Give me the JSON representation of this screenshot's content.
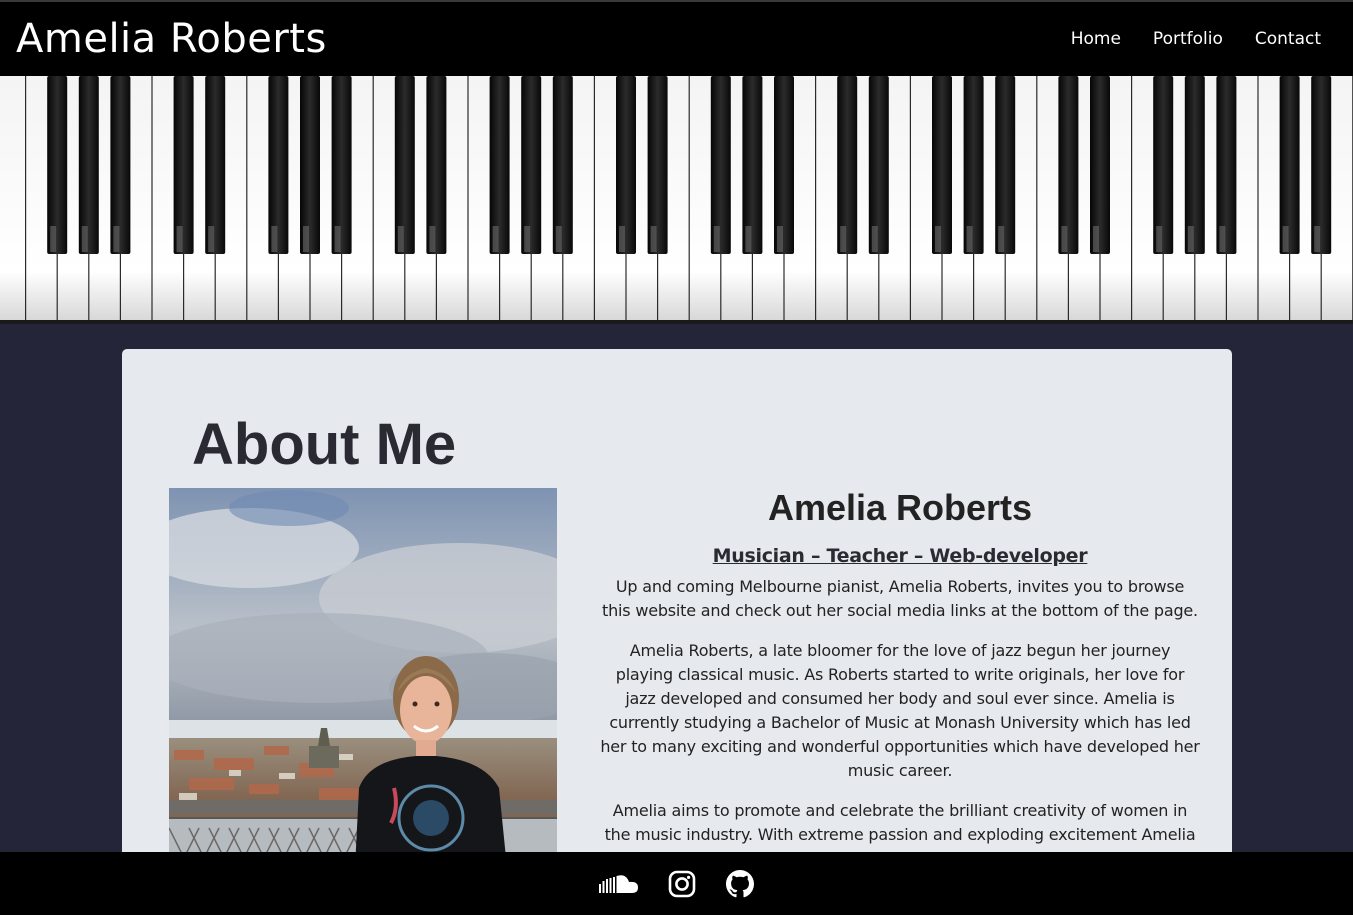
{
  "header": {
    "brand": "Amelia Roberts",
    "nav": [
      "Home",
      "Portfolio",
      "Contact"
    ]
  },
  "about": {
    "title": "About Me",
    "name": "Amelia Roberts",
    "role": "Musician – Teacher – Web-developer",
    "paragraphs": [
      "Up and coming Melbourne pianist, Amelia Roberts, invites you to browse this website and check out her social media links at the bottom of the page.",
      "Amelia Roberts, a late bloomer for the love of jazz begun her journey playing classical music. As Roberts started to write originals, her love for jazz developed and consumed her body and soul ever since. Amelia is currently studying a Bachelor of Music at Monash University which has led her to many exciting and wonderful opportunities which have developed her music career.",
      "Amelia aims to promote and celebrate the brilliant creativity of women in the music industry. With extreme passion and exploding excitement Amelia brings an utterly captivating stage presence to each show. It brings Amelia great joy to share her heart and soul with her loyal followers and audiences and invites you all to"
    ]
  },
  "footer": {
    "icons": [
      "soundcloud-icon",
      "instagram-icon",
      "github-icon"
    ]
  },
  "colors": {
    "header_bg": "#000000",
    "page_bg": "#25253a",
    "card_bg": "#e6eaee"
  }
}
